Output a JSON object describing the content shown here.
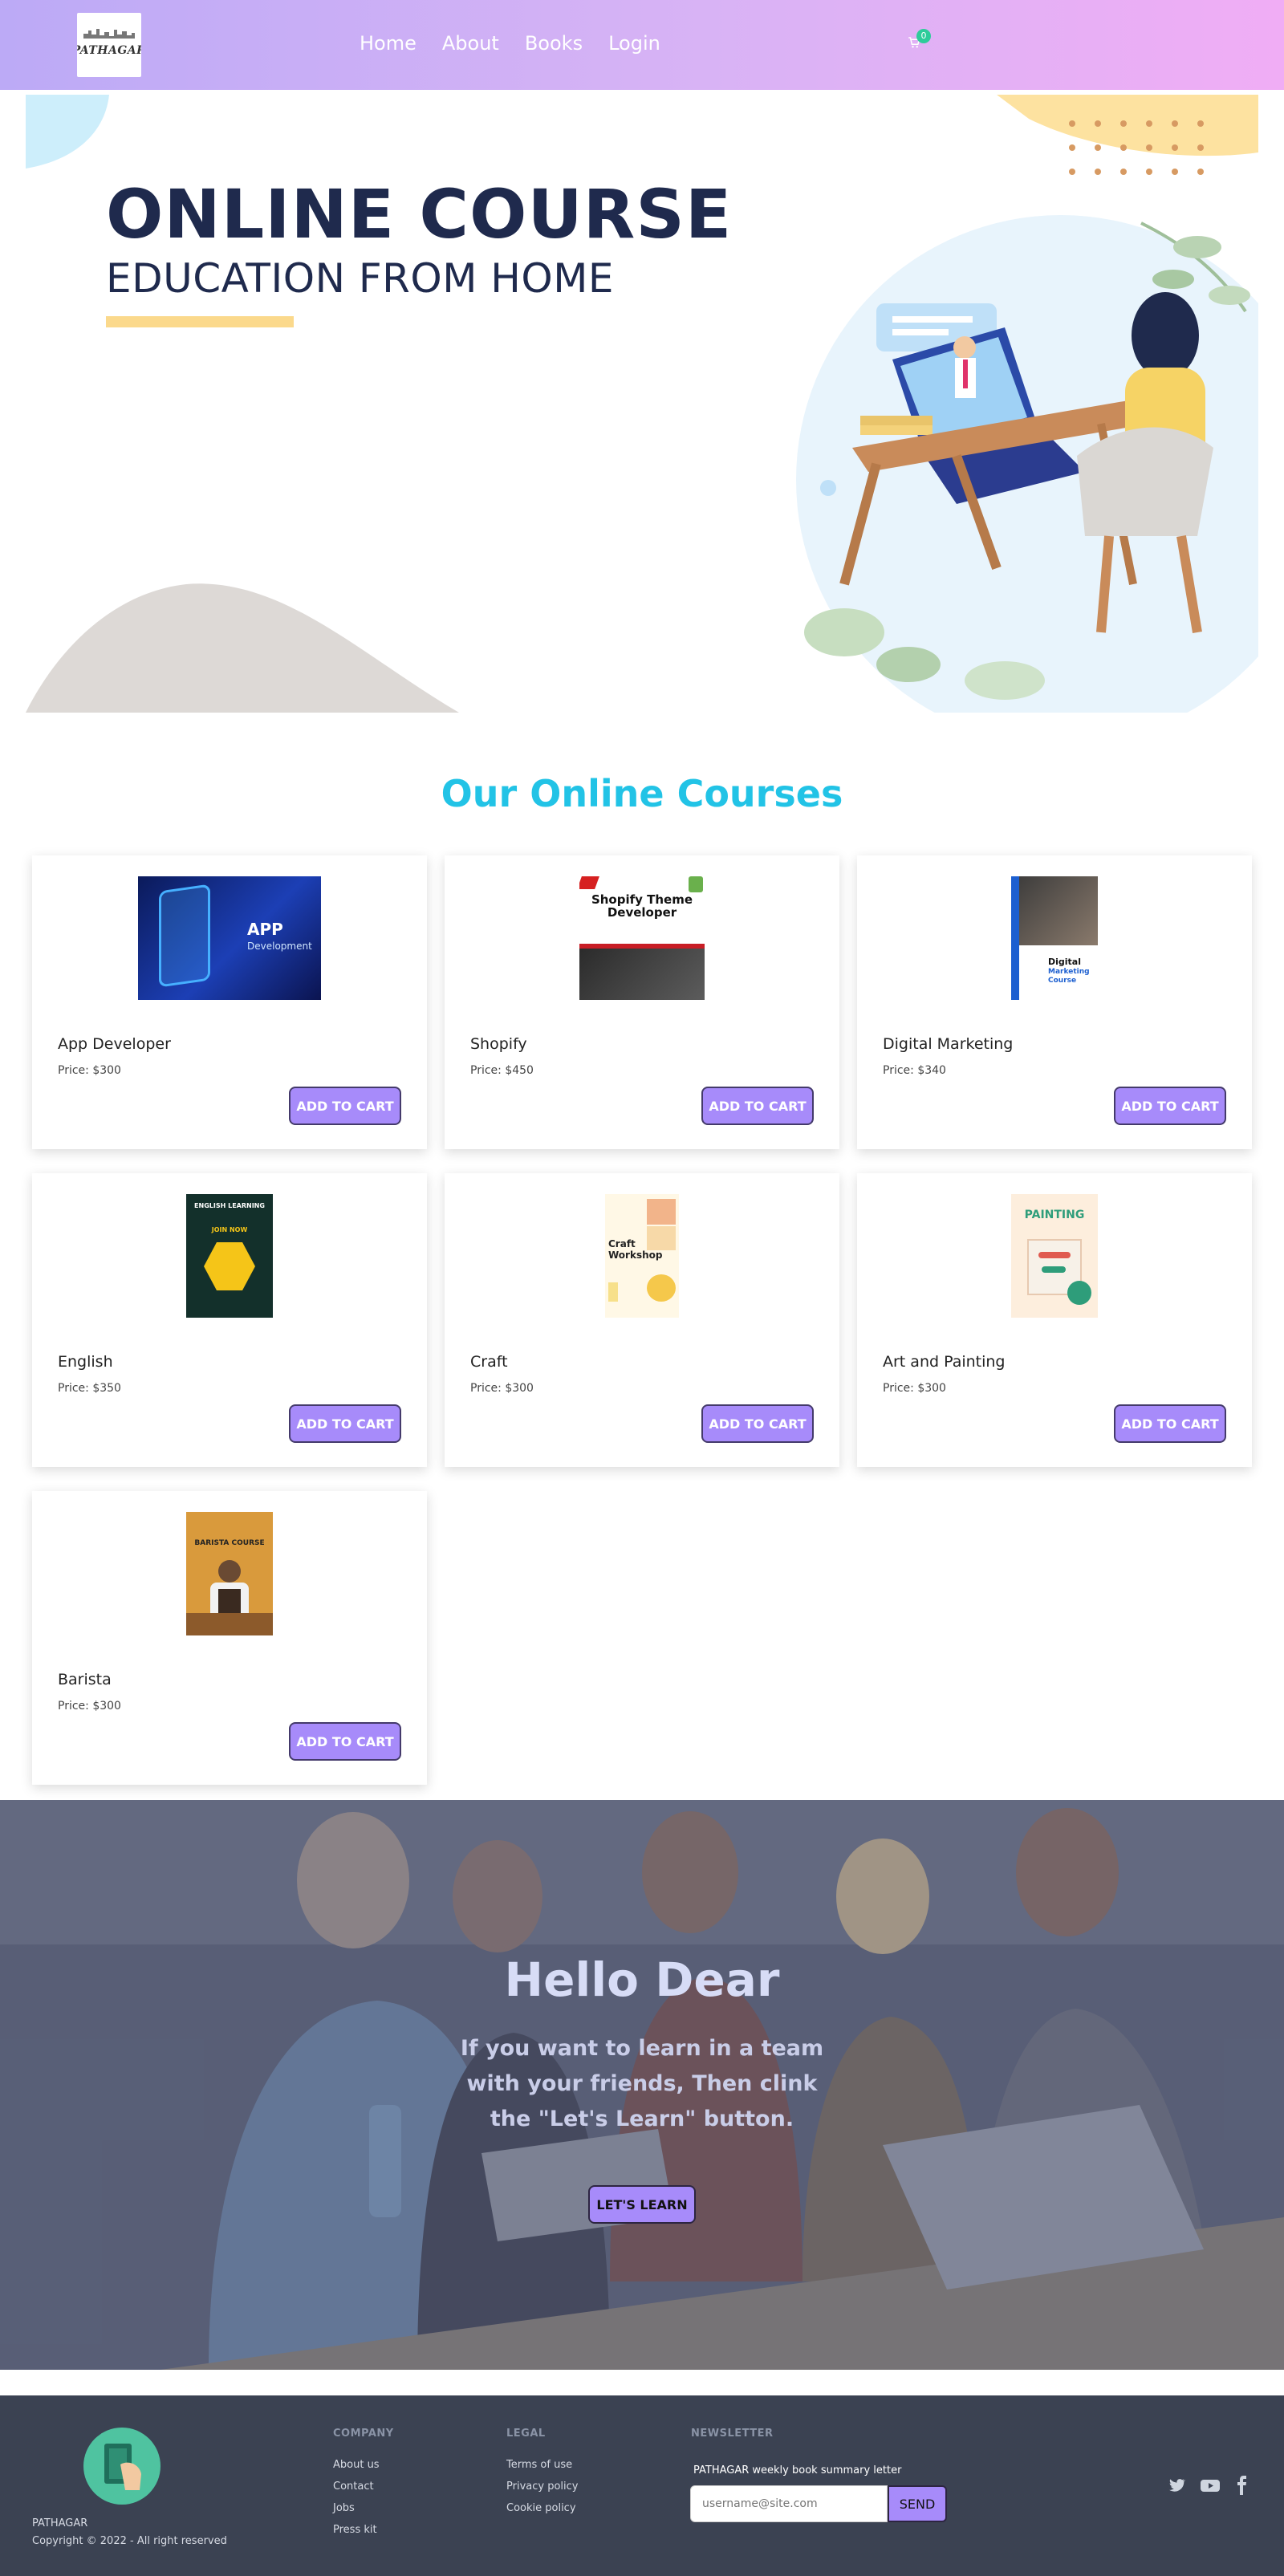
{
  "nav": {
    "logo_text": "PATHAGAR",
    "links": [
      "Home",
      "About",
      "Books",
      "Login"
    ],
    "cart_count": "0"
  },
  "hero": {
    "title": "ONLINE COURSE",
    "subtitle": "EDUCATION FROM HOME"
  },
  "courses": {
    "section_title": "Our Online Courses",
    "button_label": "ADD TO CART",
    "items": [
      {
        "name": "App Developer",
        "price": "Price: $300",
        "cover_title": "APP",
        "cover_sub": "Development"
      },
      {
        "name": "Shopify",
        "price": "Price: $450",
        "cover_title": "Shopify Theme",
        "cover_sub": "Developer"
      },
      {
        "name": "Digital Marketing",
        "price": "Price: $340",
        "cover_title": "Digital",
        "cover_sub": "Marketing Course"
      },
      {
        "name": "English",
        "price": "Price: $350",
        "cover_title": "ENGLISH LEARNING",
        "cover_sub": "JOIN NOW"
      },
      {
        "name": "Craft",
        "price": "Price: $300",
        "cover_title": "Craft",
        "cover_sub": "Workshop"
      },
      {
        "name": "Art and Painting",
        "price": "Price: $300",
        "cover_title": "PAINTING",
        "cover_sub": ""
      },
      {
        "name": "Barista",
        "price": "Price: $300",
        "cover_title": "BARISTA COURSE",
        "cover_sub": ""
      }
    ]
  },
  "banner": {
    "title": "Hello Dear",
    "text": "If you want to learn in a team with your friends, Then clink the \"Let's Learn\" button.",
    "button": "LET'S LEARN"
  },
  "footer": {
    "brand": "PATHAGAR",
    "copyright": "Copyright © 2022 - All right reserved",
    "company_heading": "COMPANY",
    "company_links": [
      "About us",
      "Contact",
      "Jobs",
      "Press kit"
    ],
    "legal_heading": "LEGAL",
    "legal_links": [
      "Terms of use",
      "Privacy policy",
      "Cookie policy"
    ],
    "newsletter_heading": "NEWSLETTER",
    "newsletter_label": "PATHAGAR weekly book summary letter",
    "newsletter_placeholder": "username@site.com",
    "newsletter_button": "SEND",
    "social_icons": [
      "twitter-icon",
      "youtube-icon",
      "facebook-icon"
    ]
  },
  "colors": {
    "accent": "#a78bfa",
    "title_cyan": "#22c3e6",
    "hero_navy": "#1f2a4d",
    "footer_bg": "#3b4252"
  }
}
